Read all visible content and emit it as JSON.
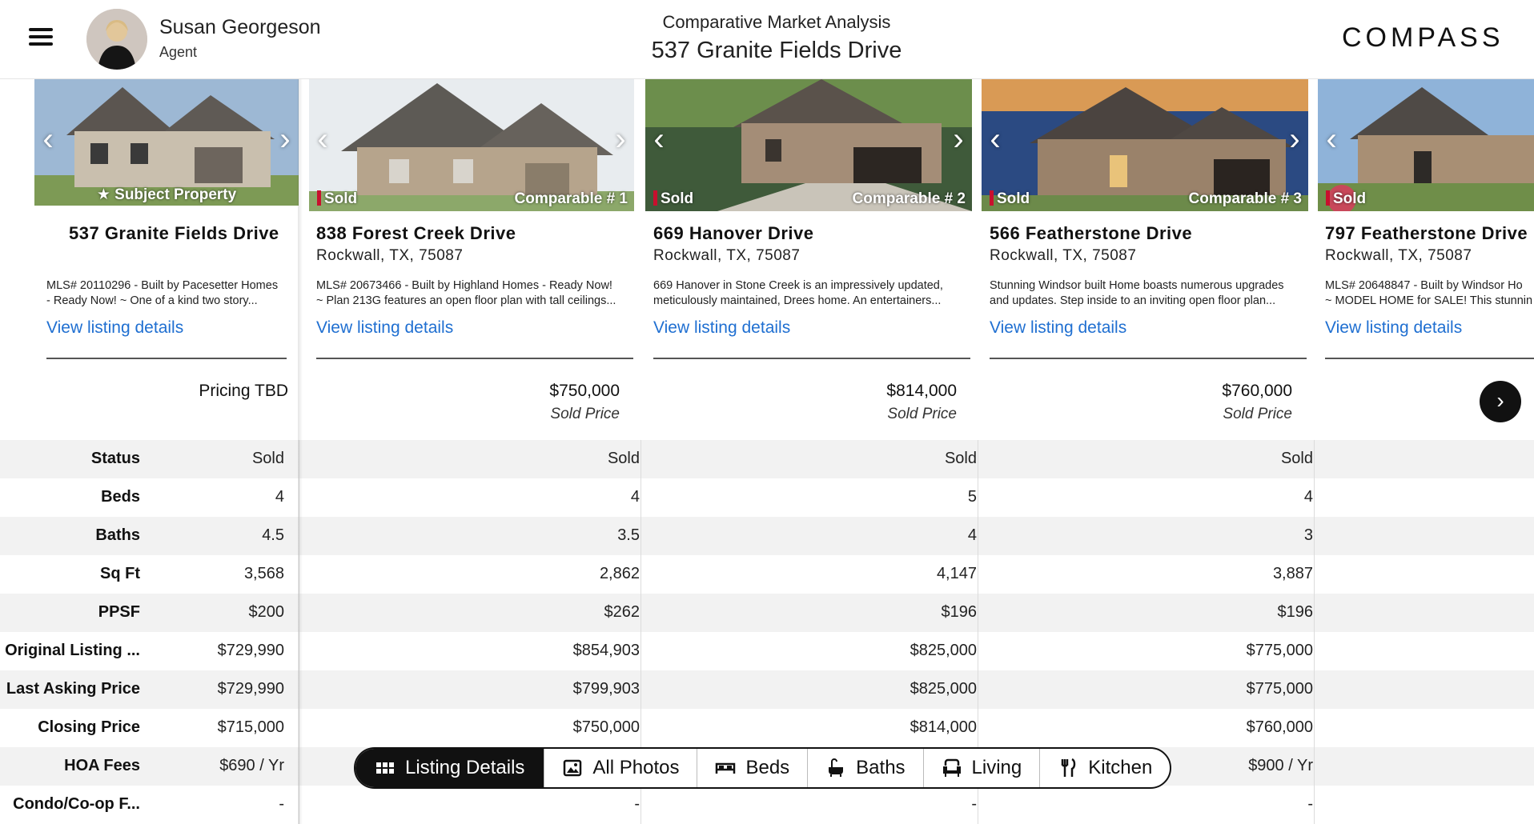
{
  "header": {
    "agent_name": "Susan Georgeson",
    "agent_role": "Agent",
    "subtitle": "Comparative Market Analysis",
    "title": "537 Granite Fields Drive",
    "logo": "COMPASS"
  },
  "subject": {
    "photo_label": "Subject Property",
    "address": "537 Granite Fields Drive",
    "description_line1": "MLS# 20110296 - Built by Pacesetter Homes",
    "description_line2": "- Ready Now! ~ One of a kind two story...",
    "view_link": "View listing details",
    "price": "Pricing TBD",
    "values": [
      "Sold",
      "4",
      "4.5",
      "3,568",
      "$200",
      "$729,990",
      "$729,990",
      "$715,000",
      "$690 / Yr",
      "-"
    ]
  },
  "comparables": [
    {
      "status_badge": "Sold",
      "comparable_label": "Comparable # 1",
      "address": "838 Forest Creek Drive",
      "city": "Rockwall, TX, 75087",
      "description_line1": "MLS# 20673466 - Built by Highland Homes - Ready Now!",
      "description_line2": "~ Plan 213G features an open floor plan with tall ceilings...",
      "view_link": "View listing details",
      "price": "$750,000",
      "price_label": "Sold Price",
      "values": [
        "Sold",
        "4",
        "3.5",
        "2,862",
        "$262",
        "$854,903",
        "$799,903",
        "$750,000",
        "",
        "-"
      ]
    },
    {
      "status_badge": "Sold",
      "comparable_label": "Comparable # 2",
      "address": "669 Hanover Drive",
      "city": "Rockwall, TX, 75087",
      "description_line1": "669 Hanover in Stone Creek is an impressively updated,",
      "description_line2": "meticulously maintained, Drees home. An entertainers...",
      "view_link": "View listing details",
      "price": "$814,000",
      "price_label": "Sold Price",
      "values": [
        "Sold",
        "5",
        "4",
        "4,147",
        "$196",
        "$825,000",
        "$825,000",
        "$814,000",
        "",
        "-"
      ]
    },
    {
      "status_badge": "Sold",
      "comparable_label": "Comparable # 3",
      "address": "566 Featherstone Drive",
      "city": "Rockwall, TX, 75087",
      "description_line1": "Stunning Windsor built Home boasts numerous upgrades",
      "description_line2": "and updates. Step inside to an inviting open floor plan...",
      "view_link": "View listing details",
      "price": "$760,000",
      "price_label": "Sold Price",
      "values": [
        "Sold",
        "4",
        "3",
        "3,887",
        "$196",
        "$775,000",
        "$775,000",
        "$760,000",
        "$900 / Yr",
        "-"
      ]
    },
    {
      "status_badge": "Sold",
      "address": "797 Featherstone Drive",
      "city": "Rockwall, TX, 75087",
      "description_line1": "MLS# 20648847 - Built by Windsor Ho",
      "description_line2": "~ MODEL HOME for SALE! This stunnin",
      "view_link": "View listing details"
    }
  ],
  "row_labels": [
    "Status",
    "Beds",
    "Baths",
    "Sq Ft",
    "PPSF",
    "Original Listing ...",
    "Last Asking Price",
    "Closing Price",
    "HOA Fees",
    "Condo/Co-op F..."
  ],
  "tabs": [
    {
      "label": "Listing Details",
      "icon": "grid-icon",
      "active": true
    },
    {
      "label": "All Photos",
      "icon": "image-icon",
      "active": false
    },
    {
      "label": "Beds",
      "icon": "bed-icon",
      "active": false
    },
    {
      "label": "Baths",
      "icon": "bath-icon",
      "active": false
    },
    {
      "label": "Living",
      "icon": "armchair-icon",
      "active": false
    },
    {
      "label": "Kitchen",
      "icon": "utensils-icon",
      "active": false
    }
  ],
  "colors": {
    "link": "#1f6fd1",
    "sold_marker": "#c8102e",
    "row_alt": "#f2f2f2"
  }
}
